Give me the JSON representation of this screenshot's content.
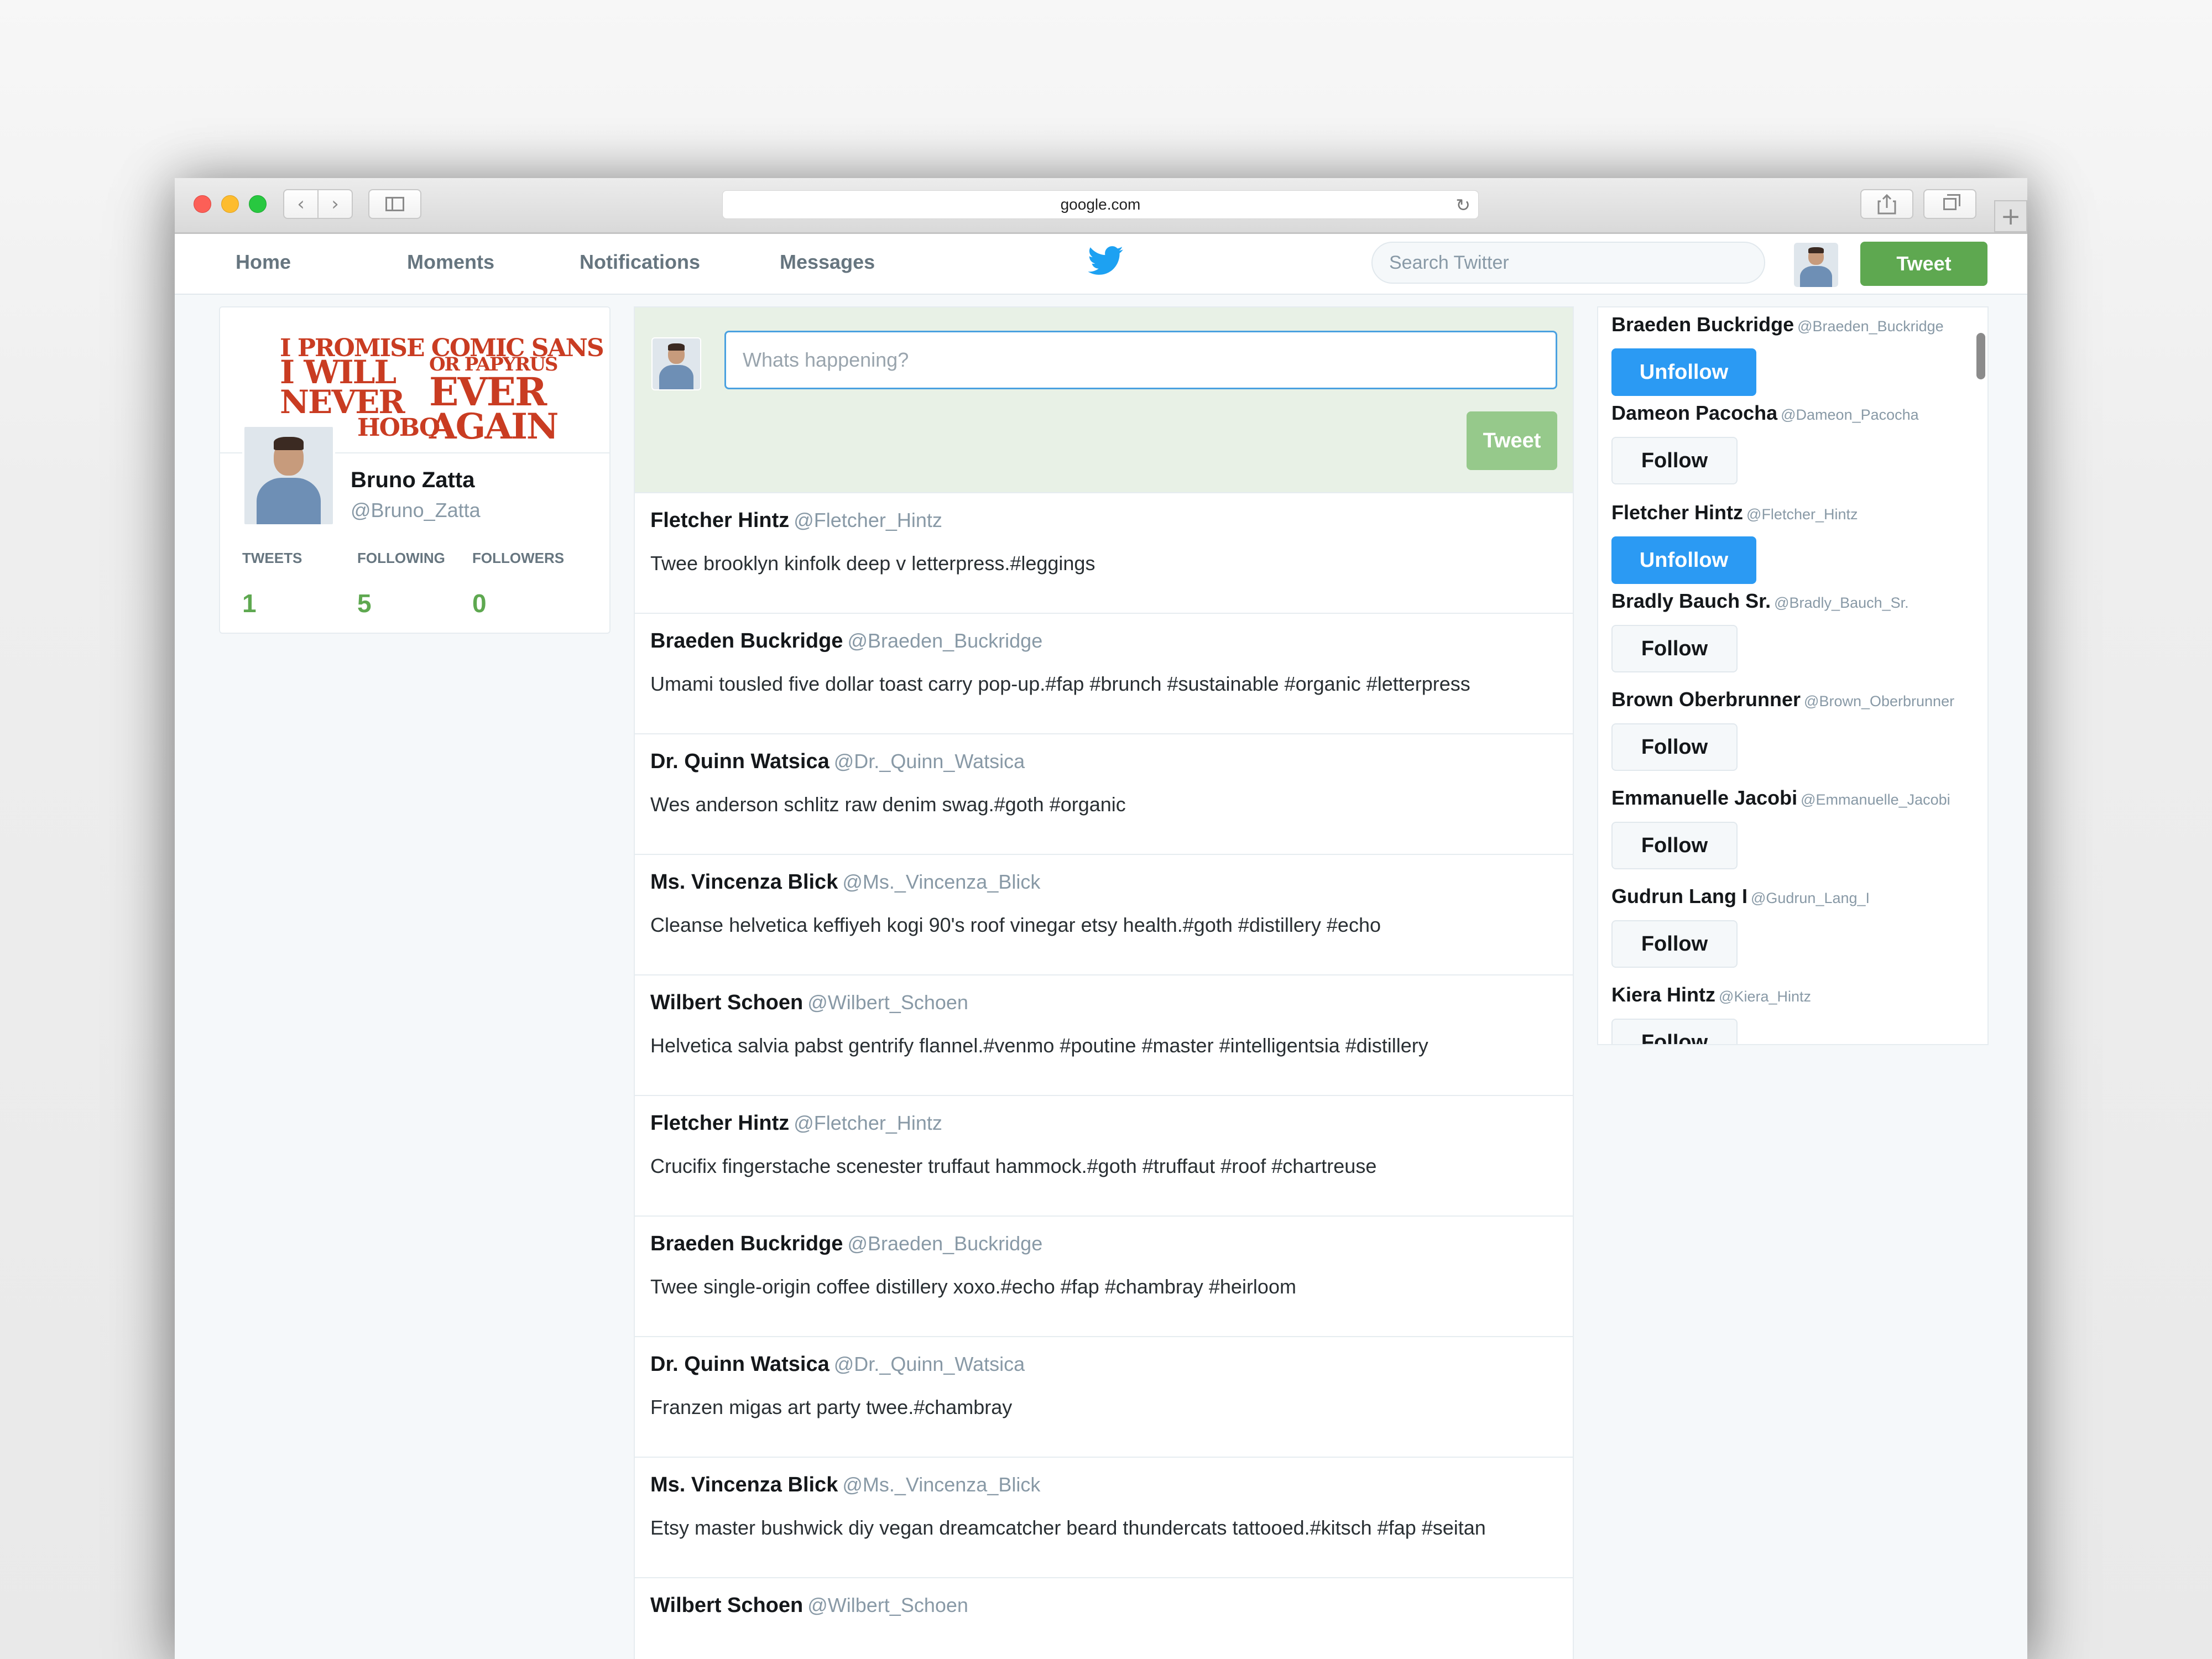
{
  "browser": {
    "address": "google.com"
  },
  "nav": {
    "home": "Home",
    "moments": "Moments",
    "notifications": "Notifications",
    "messages": "Messages",
    "search_placeholder": "Search Twitter",
    "tweet_button": "Tweet"
  },
  "profile": {
    "banner_lines": [
      "I PROMISE COMIC SANS",
      "OR PAPYRUS",
      "I WILL",
      "EVER",
      "NEVER",
      "AGAIN",
      "HOBO"
    ],
    "name": "Bruno Zatta",
    "handle": "@Bruno_Zatta",
    "stats": [
      {
        "label": "TWEETS",
        "value": "1"
      },
      {
        "label": "FOLLOWING",
        "value": "5"
      },
      {
        "label": "FOLLOWERS",
        "value": "0"
      }
    ]
  },
  "composer": {
    "placeholder": "Whats happening?",
    "tweet_button": "Tweet"
  },
  "tweets": [
    {
      "name": "Fletcher Hintz",
      "handle": "@Fletcher_Hintz",
      "text": "Twee brooklyn kinfolk deep v letterpress.#leggings"
    },
    {
      "name": "Braeden Buckridge",
      "handle": "@Braeden_Buckridge",
      "text": "Umami tousled five dollar toast carry pop-up.#fap #brunch #sustainable #organic #letterpress"
    },
    {
      "name": "Dr. Quinn Watsica",
      "handle": "@Dr._Quinn_Watsica",
      "text": "Wes anderson schlitz raw denim swag.#goth #organic"
    },
    {
      "name": "Ms. Vincenza Blick",
      "handle": "@Ms._Vincenza_Blick",
      "text": "Cleanse helvetica keffiyeh kogi 90's roof vinegar etsy health.#goth #distillery #echo"
    },
    {
      "name": "Wilbert Schoen",
      "handle": "@Wilbert_Schoen",
      "text": "Helvetica salvia pabst gentrify flannel.#venmo #poutine #master #intelligentsia #distillery"
    },
    {
      "name": "Fletcher Hintz",
      "handle": "@Fletcher_Hintz",
      "text": "Crucifix fingerstache scenester truffaut hammock.#goth #truffaut #roof #chartreuse"
    },
    {
      "name": "Braeden Buckridge",
      "handle": "@Braeden_Buckridge",
      "text": "Twee single-origin coffee distillery xoxo.#echo #fap #chambray #heirloom"
    },
    {
      "name": "Dr. Quinn Watsica",
      "handle": "@Dr._Quinn_Watsica",
      "text": "Franzen migas art party twee.#chambray"
    },
    {
      "name": "Ms. Vincenza Blick",
      "handle": "@Ms._Vincenza_Blick",
      "text": "Etsy master bushwick diy vegan dreamcatcher beard thundercats tattooed.#kitsch #fap #seitan"
    },
    {
      "name": "Wilbert Schoen",
      "handle": "@Wilbert_Schoen",
      "text": ""
    }
  ],
  "follow_list": [
    {
      "name": "Braeden Buckridge",
      "handle": "@Braeden_Buckridge",
      "button": "Unfollow"
    },
    {
      "name": "Dameon Pacocha",
      "handle": "@Dameon_Pacocha",
      "button": "Follow"
    },
    {
      "name": "Fletcher Hintz",
      "handle": "@Fletcher_Hintz",
      "button": "Unfollow"
    },
    {
      "name": "Bradly Bauch Sr.",
      "handle": "@Bradly_Bauch_Sr.",
      "button": "Follow"
    },
    {
      "name": "Brown Oberbrunner",
      "handle": "@Brown_Oberbrunner",
      "button": "Follow"
    },
    {
      "name": "Emmanuelle Jacobi",
      "handle": "@Emmanuelle_Jacobi",
      "button": "Follow"
    },
    {
      "name": "Gudrun Lang I",
      "handle": "@Gudrun_Lang_I",
      "button": "Follow"
    },
    {
      "name": "Kiera Hintz",
      "handle": "@Kiera_Hintz",
      "button": "Follow"
    }
  ],
  "colors": {
    "accent_green": "#5ea850",
    "unfollow_blue": "#2b9af3",
    "twitter_blue": "#1da1f2"
  }
}
